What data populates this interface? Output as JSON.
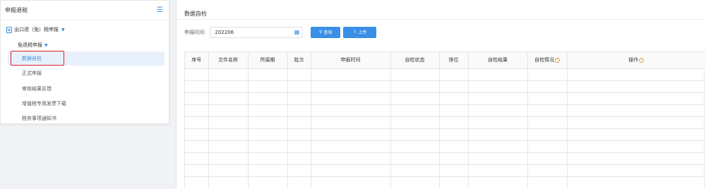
{
  "sidebar": {
    "title": "申报退税",
    "root_label": "出口退（免）税申报",
    "sub_label": "免退税申报",
    "items": [
      {
        "label": "数据自检",
        "active": true
      },
      {
        "label": "正式申报",
        "active": false
      },
      {
        "label": "审核结果反馈",
        "active": false
      },
      {
        "label": "增值税专用发票下载",
        "active": false
      },
      {
        "label": "税务事项通知书",
        "active": false
      }
    ]
  },
  "main": {
    "title": "数据自检",
    "period_label": "申报时间:",
    "period_value": "202206",
    "query_label": "查询",
    "upload_label": "上传",
    "table": {
      "columns": [
        "序号",
        "文件名称",
        "所属期",
        "批次",
        "申报时间",
        "自检状态",
        "排位",
        "自检结果",
        "自检情况",
        "操作"
      ],
      "empty_rows": 10
    }
  },
  "colors": {
    "accent": "#3a8ee6",
    "highlight_border": "#e02020",
    "help_icon": "#e6a23c"
  }
}
